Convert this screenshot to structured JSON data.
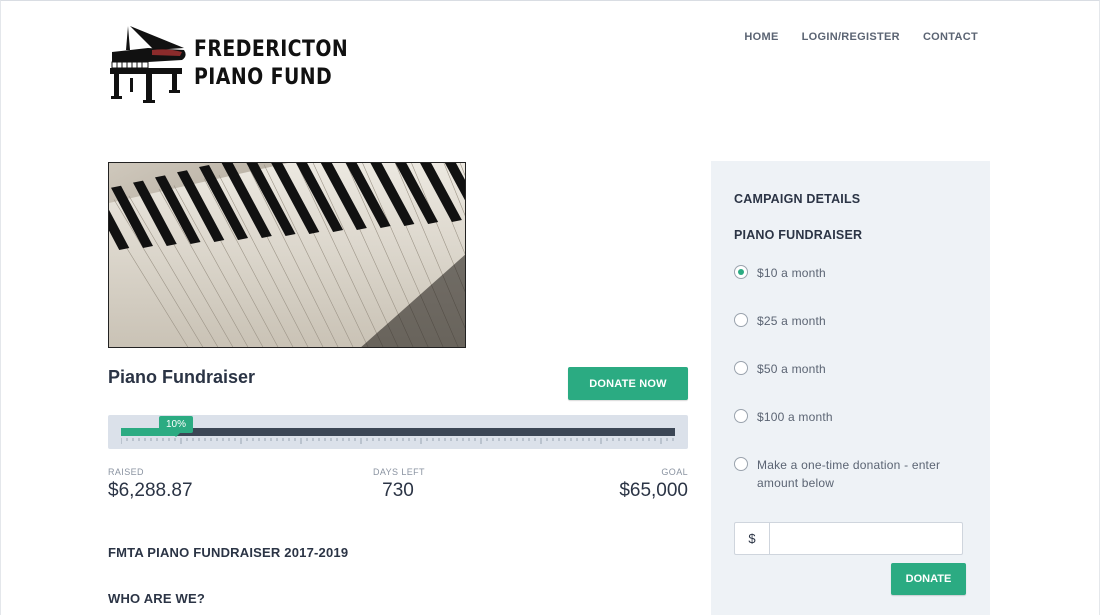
{
  "brand": {
    "line1": "FREDERICTON",
    "line2": "PIANO FUND",
    "icon": "grand-piano-icon"
  },
  "nav": {
    "items": [
      {
        "label": "HOME"
      },
      {
        "label": "LOGIN/REGISTER"
      },
      {
        "label": "CONTACT"
      }
    ]
  },
  "hero": {
    "image": "piano-keys-photo"
  },
  "campaign": {
    "title": "Piano Fundraiser",
    "donate_now_label": "DONATE NOW",
    "progress_percent_label": "10%",
    "progress_fraction": 0.1,
    "stats": {
      "raised_label": "RAISED",
      "raised_value": "$6,288.87",
      "days_left_label": "DAYS LEFT",
      "days_left_value": "730",
      "goal_label": "GOAL",
      "goal_value": "$65,000"
    },
    "section_heading": "FMTA PIANO FUNDRAISER 2017-2019",
    "subheading": "WHO ARE WE?"
  },
  "sidebar": {
    "title": "CAMPAIGN DETAILS",
    "subtitle": "PIANO FUNDRAISER",
    "options": [
      {
        "label": "$10 a month",
        "checked": true
      },
      {
        "label": "$25 a month",
        "checked": false
      },
      {
        "label": "$50 a month",
        "checked": false
      },
      {
        "label": "$100 a month",
        "checked": false
      },
      {
        "label": "Make a one-time donation - enter amount below",
        "checked": false
      }
    ],
    "currency_symbol": "$",
    "amount_value": "",
    "donate_label": "DONATE"
  },
  "colors": {
    "accent": "#2bab82",
    "dark": "#3b4655",
    "sidebar_bg": "#eef2f6"
  }
}
